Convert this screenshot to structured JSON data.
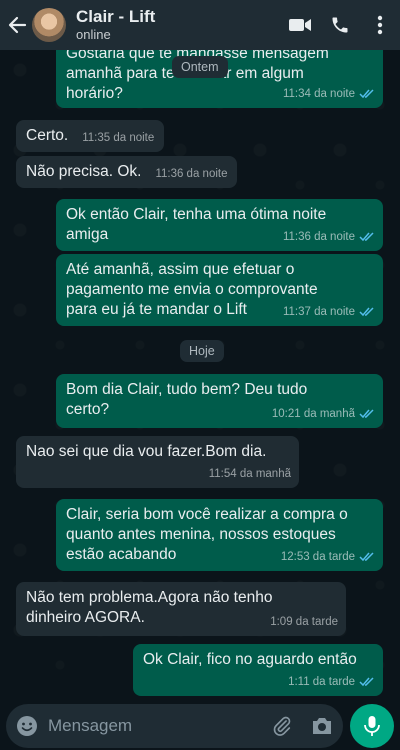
{
  "header": {
    "title": "Clair - Lift",
    "status": "online"
  },
  "dates": {
    "yesterday": "Ontem",
    "today": "Hoje"
  },
  "messages": [
    {
      "dir": "out",
      "lines": [
        "Gostaria que te mandasse mensagem",
        "amanhã para te lembrar em algum",
        "horário?"
      ],
      "time": "11:34 da noite"
    },
    {
      "dir": "in",
      "text": "Certo.",
      "time": "11:35 da noite"
    },
    {
      "dir": "in",
      "text": "Não precisa. Ok.",
      "time": "11:36 da noite"
    },
    {
      "dir": "out",
      "lines": [
        "Ok então Clair, tenha uma ótima noite",
        "amiga"
      ],
      "time": "11:36 da noite"
    },
    {
      "dir": "out",
      "lines": [
        "Até amanhã, assim que efetuar o",
        "pagamento me envia o comprovante",
        "para eu já te mandar o Lift"
      ],
      "time": "11:37 da noite"
    },
    {
      "dir": "out",
      "lines": [
        "Bom dia Clair, tudo bem? Deu tudo",
        "certo?"
      ],
      "time": "10:21 da manhã"
    },
    {
      "dir": "in",
      "lines": [
        "Nao sei que dia vou fazer.Bom dia."
      ],
      "time": "11:54 da manhã"
    },
    {
      "dir": "out",
      "lines": [
        "Clair, seria bom você realizar a compra o",
        "quanto antes menina, nossos estoques",
        "estão acabando"
      ],
      "time": "12:53 da tarde"
    },
    {
      "dir": "in",
      "lines": [
        "Não tem problema.Agora não tenho",
        "dinheiro AGORA."
      ],
      "time": "1:09 da tarde"
    },
    {
      "dir": "out",
      "lines": [
        "Ok Clair, fico no aguardo então"
      ],
      "time": "1:11 da tarde"
    }
  ],
  "composer": {
    "placeholder": "Mensagem"
  },
  "colors": {
    "outgoing": "#005c4b",
    "incoming": "#202c33",
    "header": "#1f2c34",
    "accent": "#00a884",
    "read_ticks": "#53bdeb"
  },
  "icons": [
    "back-arrow-icon",
    "video-call-icon",
    "phone-icon",
    "more-vert-icon",
    "emoji-icon",
    "attach-icon",
    "camera-icon",
    "mic-icon",
    "double-check-icon"
  ]
}
